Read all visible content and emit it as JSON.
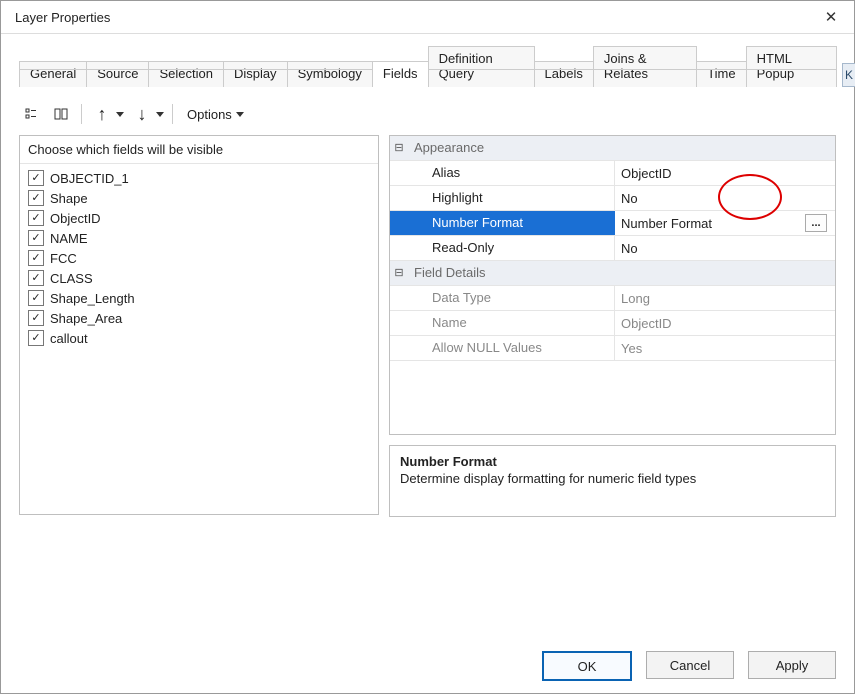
{
  "window": {
    "title": "Layer Properties"
  },
  "tabs": [
    {
      "label": "General",
      "active": false
    },
    {
      "label": "Source",
      "active": false
    },
    {
      "label": "Selection",
      "active": false
    },
    {
      "label": "Display",
      "active": false
    },
    {
      "label": "Symbology",
      "active": false
    },
    {
      "label": "Fields",
      "active": true
    },
    {
      "label": "Definition Query",
      "active": false
    },
    {
      "label": "Labels",
      "active": false
    },
    {
      "label": "Joins & Relates",
      "active": false
    },
    {
      "label": "Time",
      "active": false
    },
    {
      "label": "HTML Popup",
      "active": false
    }
  ],
  "options_label": "Options",
  "left": {
    "header": "Choose which fields will be visible",
    "items": [
      {
        "label": "OBJECTID_1",
        "checked": true
      },
      {
        "label": "Shape",
        "checked": true
      },
      {
        "label": "ObjectID",
        "checked": true
      },
      {
        "label": "NAME",
        "checked": true
      },
      {
        "label": "FCC",
        "checked": true
      },
      {
        "label": "CLASS",
        "checked": true
      },
      {
        "label": "Shape_Length",
        "checked": true
      },
      {
        "label": "Shape_Area",
        "checked": true
      },
      {
        "label": "callout",
        "checked": true
      }
    ]
  },
  "propgrid": {
    "cat1": "Appearance",
    "appearance": [
      {
        "key": "Alias",
        "val": "ObjectID",
        "selected": false
      },
      {
        "key": "Highlight",
        "val": "No",
        "selected": false
      },
      {
        "key": "Number Format",
        "val": "Number Format",
        "selected": true,
        "has_btn": true
      },
      {
        "key": "Read-Only",
        "val": "No",
        "selected": false
      }
    ],
    "cat2": "Field Details",
    "details": [
      {
        "key": "Data Type",
        "val": "Long"
      },
      {
        "key": "Name",
        "val": "ObjectID"
      },
      {
        "key": "Allow NULL Values",
        "val": "Yes"
      }
    ]
  },
  "description": {
    "title": "Number Format",
    "text": "Determine display formatting for numeric field types"
  },
  "buttons": {
    "ok": "OK",
    "cancel": "Cancel",
    "apply": "Apply"
  },
  "behind_ok_char": "K"
}
